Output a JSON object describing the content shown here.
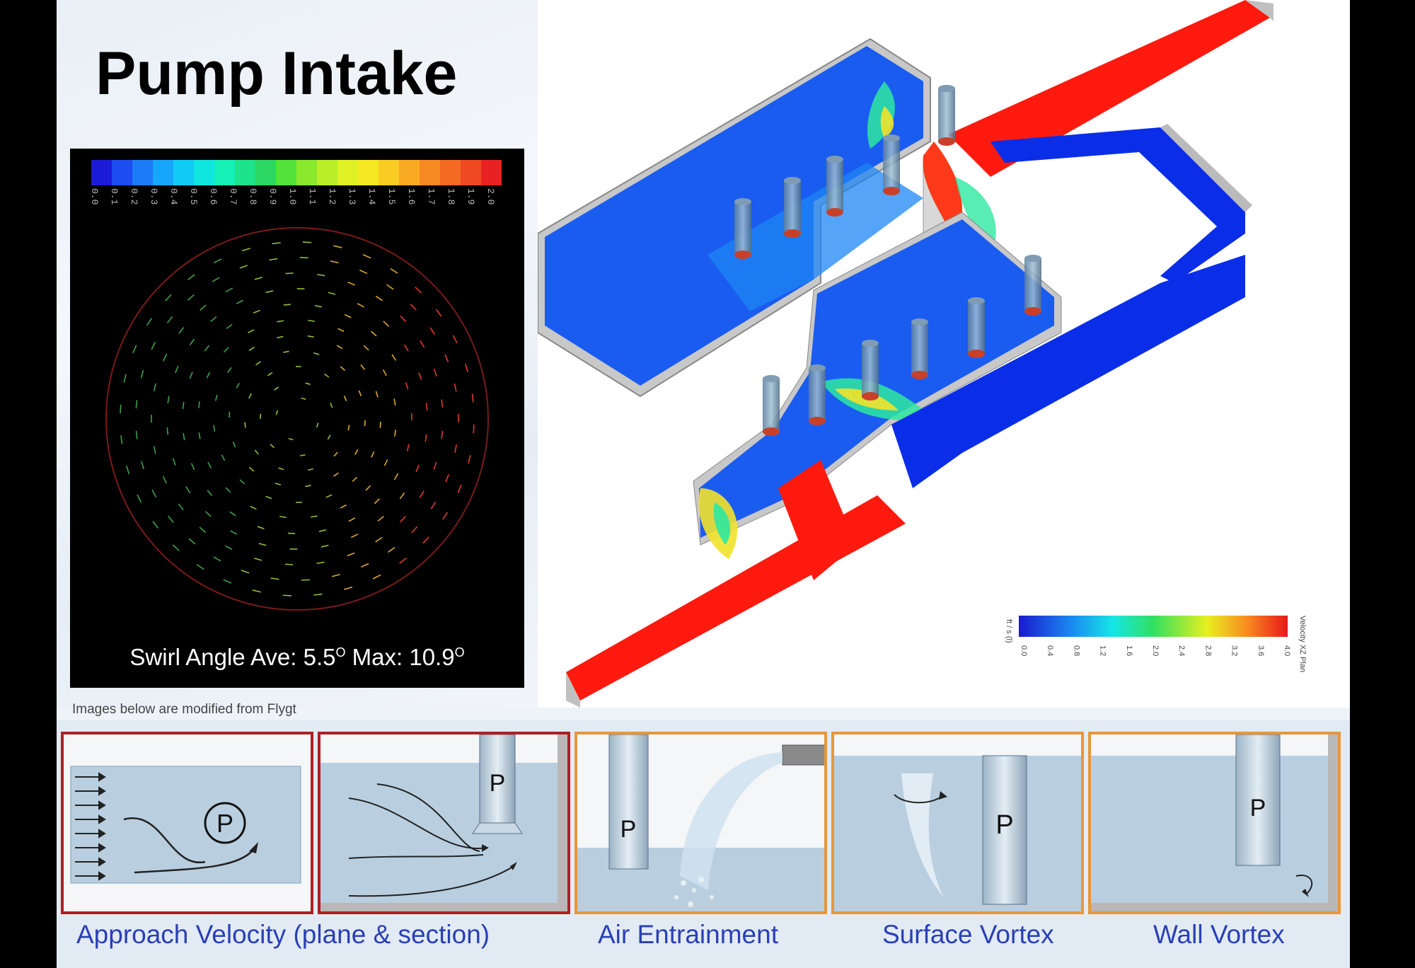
{
  "title": "Pump Intake",
  "swirl": {
    "caption_prefix": "Swirl Angle Ave: 5.5",
    "caption_deg1": "O",
    "caption_mid": " Max: 10.9",
    "caption_deg2": "O",
    "scale_ticks": [
      "0.0",
      "0.1",
      "0.2",
      "0.3",
      "0.4",
      "0.5",
      "0.6",
      "0.7",
      "0.8",
      "0.9",
      "1.0",
      "1.1",
      "1.2",
      "1.3",
      "1.4",
      "1.5",
      "1.6",
      "1.7",
      "1.8",
      "1.9",
      "2.0"
    ]
  },
  "credit": "Images below are modified from Flygt",
  "velocity_legend": {
    "label_left": "ft / s (l)",
    "label_right": "Velocity XZ Plan",
    "ticks": [
      "0.0",
      "0.4",
      "0.8",
      "1.2",
      "1.6",
      "2.0",
      "2.4",
      "2.8",
      "3.2",
      "3.6",
      "4.0"
    ]
  },
  "panels": [
    {
      "pump_label": "P"
    },
    {
      "pump_label": "P"
    },
    {
      "pump_label": "P"
    },
    {
      "pump_label": "P"
    },
    {
      "pump_label": "P"
    }
  ],
  "captions": {
    "approach": "Approach Velocity (plane & section)",
    "air": "Air Entrainment",
    "surface": "Surface Vortex",
    "wall": "Wall Vortex"
  },
  "colors": {
    "caption_blue": "#2a3fb7",
    "panel_red_border": "#b01e24",
    "panel_orange_border": "#e8963b",
    "flow_red": "#ff1a0f",
    "flow_blue": "#0a3cf0"
  }
}
